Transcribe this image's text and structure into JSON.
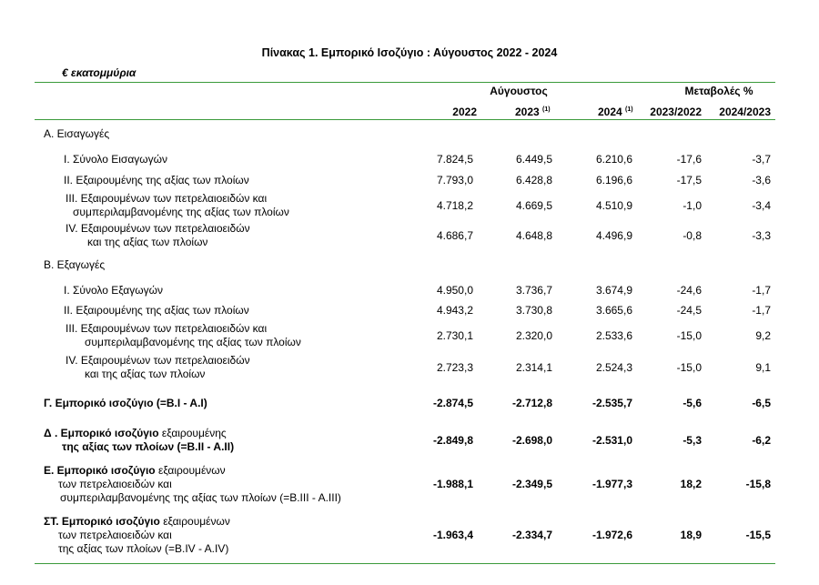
{
  "title": "Πίνακας 1. Εμπορικό Ισοζύγιο :  Αύγουστος 2022  - 2024",
  "unit": "€ εκατομμύρια",
  "header": {
    "group_august": "Αύγουστος",
    "group_changes": "Μεταβολές %",
    "col_2022": "2022",
    "col_2023": "2023",
    "col_2023_note": "(1)",
    "col_2024": "2024",
    "col_2024_note": "(1)",
    "col_ch1": "2023/2022",
    "col_ch2": "2024/2023"
  },
  "sections": {
    "imports": "Α. Εισαγωγές",
    "exports": "Β. Εξαγωγές"
  },
  "rows": [
    {
      "label1": "I.  Σύνολο Εισαγωγών",
      "label2": "",
      "v2022": "7.824,5",
      "v2023": "6.449,5",
      "v2024": "6.210,6",
      "ch1": "-17,6",
      "ch2": "-3,7"
    },
    {
      "label1": "II.  Εξαιρουμένης  της αξίας των πλοίων",
      "label2": "",
      "v2022": "7.793,0",
      "v2023": "6.428,8",
      "v2024": "6.196,6",
      "ch1": "-17,5",
      "ch2": "-3,6"
    },
    {
      "label1": "III. Εξαιρουμένων των πετρελαιοειδών και",
      "label2": "συμπεριλαμβανομένης της αξίας των πλοίων",
      "v2022": "4.718,2",
      "v2023": "4.669,5",
      "v2024": "4.510,9",
      "ch1": "-1,0",
      "ch2": "-3,4"
    },
    {
      "label1": "IV. Εξαιρουμένων των πετρελαιοειδών",
      "label2": "και της αξίας των πλοίων",
      "v2022": "4.686,7",
      "v2023": "4.648,8",
      "v2024": "4.496,9",
      "ch1": "-0,8",
      "ch2": "-3,3"
    },
    {
      "label1": "I.  Σύνολο Εξαγωγών",
      "label2": "",
      "v2022": "4.950,0",
      "v2023": "3.736,7",
      "v2024": "3.674,9",
      "ch1": "-24,6",
      "ch2": "-1,7"
    },
    {
      "label1": "II.  Εξαιρουμένης  της αξίας των πλοίων",
      "label2": "",
      "v2022": "4.943,2",
      "v2023": "3.730,8",
      "v2024": "3.665,6",
      "ch1": "-24,5",
      "ch2": "-1,7"
    },
    {
      "label1": "III. Εξαιρουμένων των πετρελαιοειδών και",
      "label2": "συμπεριλαμβανομένης της αξίας των πλοίων",
      "v2022": "2.730,1",
      "v2023": "2.320,0",
      "v2024": "2.533,6",
      "ch1": "-15,0",
      "ch2": "9,2"
    },
    {
      "label1": "IV. Εξαιρουμένων των πετρελαιοειδών",
      "label2": "και της αξίας των πλοίων",
      "v2022": "2.723,3",
      "v2023": "2.314,1",
      "v2024": "2.524,3",
      "ch1": "-15,0",
      "ch2": "9,1"
    }
  ],
  "balances": [
    {
      "bold1": "Γ. Εμπορικό ισοζύγιο (=B.I - A.I)",
      "rest1": "",
      "line2": "",
      "line3": "",
      "v2022": "-2.874,5",
      "v2023": "-2.712,8",
      "v2024": "-2.535,7",
      "ch1": "-5,6",
      "ch2": "-6,5"
    },
    {
      "bold1": "Δ . Εμπορικό ισοζύγιο",
      "rest1": " εξαιρουμένης",
      "line2": "της αξίας των πλοίων (=B.II - A.II)",
      "line3": "",
      "v2022": "-2.849,8",
      "v2023": "-2.698,0",
      "v2024": "-2.531,0",
      "ch1": "-5,3",
      "ch2": "-6,2"
    },
    {
      "bold1": "Ε. Εμπορικό ισοζύγιο",
      "rest1": " εξαιρουμένων",
      "line2": "των πετρελαιοειδών και",
      "line3": "συμπεριλαμβανομένης της αξίας των πλοίων (=B.III - A.III)",
      "v2022": "-1.988,1",
      "v2023": "-2.349,5",
      "v2024": "-1.977,3",
      "ch1": "18,2",
      "ch2": "-15,8"
    },
    {
      "bold1": "ΣΤ. Εμπορικό ισοζύγιο",
      "rest1": " εξαιρουμένων",
      "line2": "των πετρελαιοειδών και",
      "line3": "της αξίας των πλοίων (=B.IV - A.IV)",
      "v2022": "-1.963,4",
      "v2023": "-2.334,7",
      "v2024": "-1.972,6",
      "ch1": "18,9",
      "ch2": "-15,5"
    }
  ]
}
